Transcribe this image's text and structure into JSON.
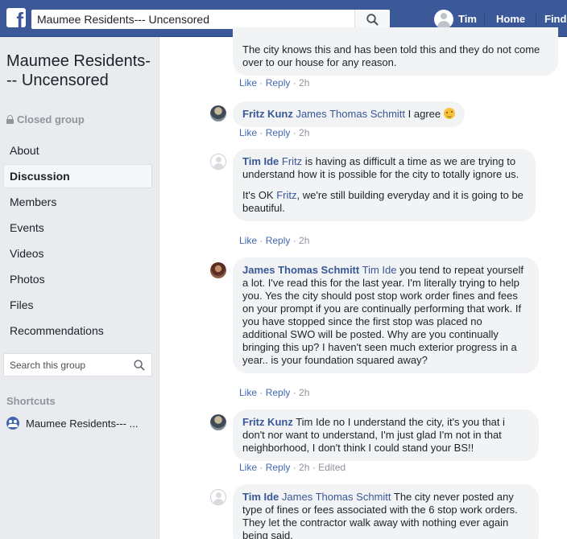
{
  "topbar": {
    "logo_letter": "f",
    "search_value": "Maumee Residents--- Uncensored",
    "user_name": "Tim",
    "home_label": "Home",
    "find_label": "Find"
  },
  "sidebar": {
    "group_title": "Maumee Residents--- Uncensored",
    "group_privacy": "Closed group",
    "nav": [
      {
        "label": "About"
      },
      {
        "label": "Discussion"
      },
      {
        "label": "Members"
      },
      {
        "label": "Events"
      },
      {
        "label": "Videos"
      },
      {
        "label": "Photos"
      },
      {
        "label": "Files"
      },
      {
        "label": "Recommendations"
      }
    ],
    "search_placeholder": "Search this group",
    "shortcuts_title": "Shortcuts",
    "shortcut_label": "Maumee Residents--- ..."
  },
  "comments": [
    {
      "author": "",
      "text": "The city knows this and has been told this and they do not come over to our house for any reason.",
      "like": "Like",
      "reply": "Reply",
      "time": "2h"
    },
    {
      "author": "Fritz Kunz",
      "mention": "James Thomas Schmitt",
      "text": " I agree ",
      "emoji": "smile-emoji",
      "like": "Like",
      "reply": "Reply",
      "time": "2h"
    },
    {
      "author": "Tim Ide",
      "mention": "Fritz",
      "text": " is having as difficult a time as we are trying to understand how it is possible for the city to totally ignore us.",
      "para2_prefix": "It's OK ",
      "para2_mention": "Fritz",
      "para2_text": ", we're still building everyday and it is going to be beautiful.",
      "like": "Like",
      "reply": "Reply",
      "time": "2h"
    },
    {
      "author": "James Thomas Schmitt",
      "mention": "Tim Ide",
      "text": " you tend to repeat yourself a lot. I've read this for the last year. I'm literally trying to help you. Yes the city should post stop work order fines and fees on your prompt if you are continually performing that work. If you have stopped since the first stop was placed no additional SWO will be posted. Why are you continually bringing this up? I haven't seen much exterior progress in a year.. is your foundation squared away?",
      "like": "Like",
      "reply": "Reply",
      "time": "2h"
    },
    {
      "author": "Fritz Kunz",
      "text": " Tim Ide no I understand the city, it's you that i don't nor want to understand, I'm just glad I'm not in that neighborhood, I don't think I could stand your BS!!",
      "like": "Like",
      "reply": "Reply",
      "time": "2h",
      "edited": "Edited"
    },
    {
      "author": "Tim Ide",
      "mention": "James Thomas Schmitt",
      "text": " The city never posted any type of fines or fees associated with the 6 stop work orders. They let the contractor walk away with nothing ever again being said."
    }
  ],
  "colors": {
    "topbar": "#3b5998",
    "link": "#385898",
    "bubble": "#f2f3f5",
    "sidebar": "#e9ebee"
  }
}
